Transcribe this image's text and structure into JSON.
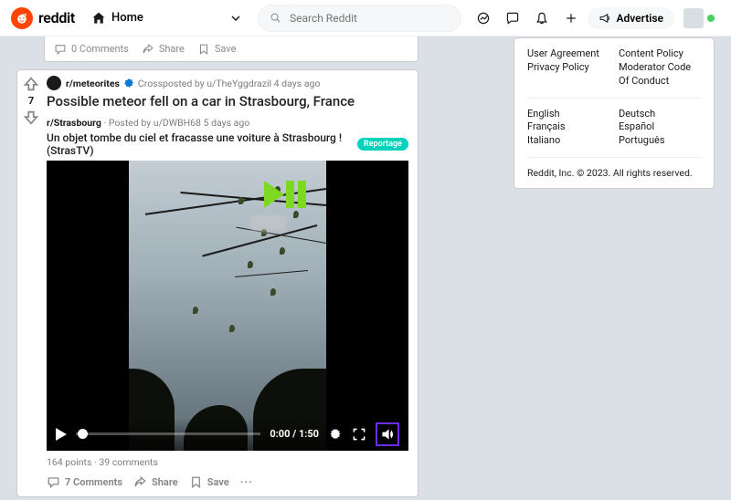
{
  "header": {
    "brand": "reddit",
    "home_label": "Home",
    "search_placeholder": "Search Reddit",
    "advertise_label": "Advertise"
  },
  "partial_actions": {
    "comments": "0 Comments",
    "share": "Share",
    "save": "Save"
  },
  "post": {
    "vote_count": "7",
    "subreddit": "r/meteorites",
    "crosspost_meta": "Crossposted by u/TheYggdrazil 4 days ago",
    "title": "Possible meteor fell on a car in Strasbourg, France",
    "cross_sub": "r/Strasbourg",
    "cross_posted_by": "Posted by u/DWBH68 5 days ago",
    "cross_title": "Un objet tombe du ciel et fracasse une voiture à Strasbourg ! (StrasTV)",
    "tag": "Reportage",
    "stats": {
      "points": "164 points",
      "comments": "39 comments"
    },
    "actions": {
      "comments": "7 Comments",
      "share": "Share",
      "save": "Save"
    }
  },
  "video": {
    "current_time": "0:00",
    "duration": "1:50"
  },
  "sidebar": {
    "links_left": [
      "User Agreement",
      "Privacy Policy"
    ],
    "links_right": [
      "Content Policy",
      "Moderator Code Of Conduct"
    ],
    "langs_left": [
      "English",
      "Français",
      "Italiano"
    ],
    "langs_right": [
      "Deutsch",
      "Español",
      "Português"
    ],
    "copyright": "Reddit, Inc. © 2023. All rights reserved."
  }
}
